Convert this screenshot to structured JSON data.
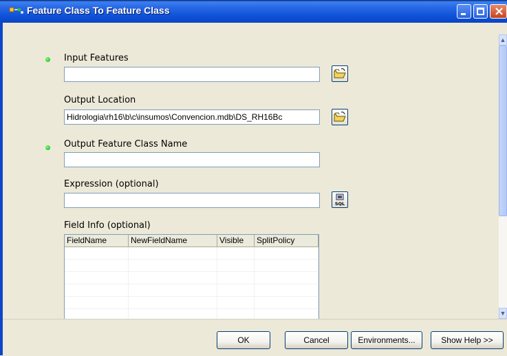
{
  "window": {
    "title": "Feature Class To Feature Class"
  },
  "form": {
    "input_features": {
      "label": "Input Features",
      "value": ""
    },
    "output_location": {
      "label": "Output Location",
      "value": "Hidrologia\\rh16\\b\\c\\insumos\\Convencion.mdb\\DS_RH16Bc"
    },
    "output_name": {
      "label": "Output Feature Class Name",
      "value": ""
    },
    "expression": {
      "label": "Expression (optional)",
      "value": ""
    },
    "field_info": {
      "label": "Field Info (optional)",
      "columns": [
        "FieldName",
        "NewFieldName",
        "Visible",
        "SplitPolicy"
      ]
    }
  },
  "icons": {
    "browse": "folder-open-icon",
    "sql": "sql-icon",
    "required": "green-dot-icon"
  },
  "buttons": {
    "ok": "OK",
    "cancel": "Cancel",
    "environments": "Environments...",
    "show_help": "Show Help >>"
  },
  "scroll": {
    "up": "^",
    "down": "v"
  }
}
